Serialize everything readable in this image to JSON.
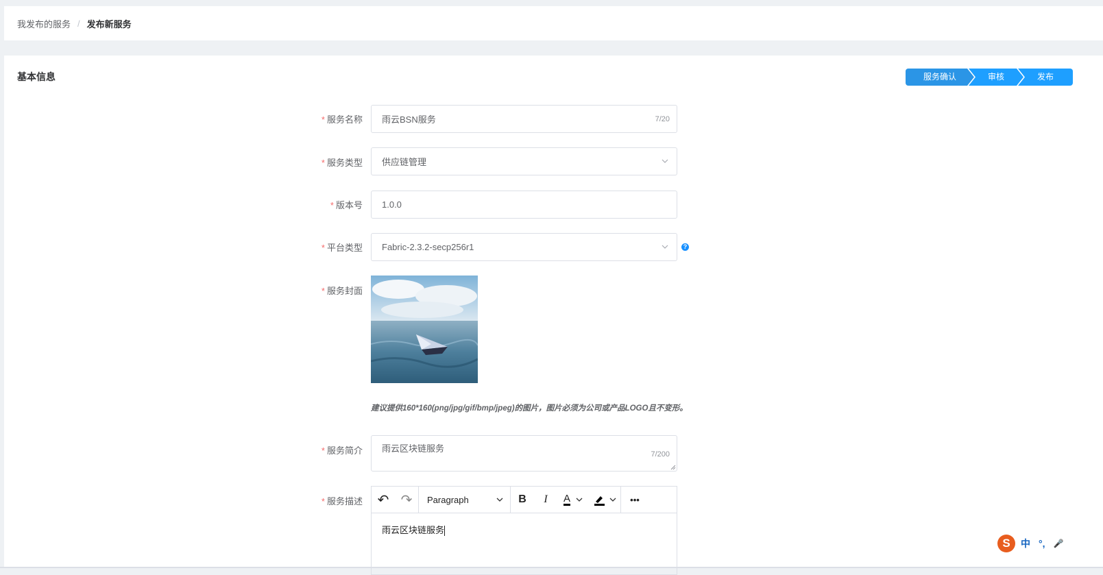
{
  "breadcrumb": {
    "parent": "我发布的服务",
    "separator": "/",
    "current": "发布新服务"
  },
  "section_title": "基本信息",
  "steps": [
    "服务确认",
    "审核",
    "发布"
  ],
  "form": {
    "required_mark": "*",
    "name": {
      "label": "服务名称",
      "value": "雨云BSN服务",
      "counter": "7/20"
    },
    "type": {
      "label": "服务类型",
      "value": "供应链管理"
    },
    "version": {
      "label": "版本号",
      "value": "1.0.0"
    },
    "platform": {
      "label": "平台类型",
      "value": "Fabric-2.3.2-secp256r1",
      "help": "?"
    },
    "cover": {
      "label": "服务封面",
      "hint": "建议提供160*160(png/jpg/gif/bmp/jpeg)的图片，图片必须为公司或产品LOGO且不变形。"
    },
    "intro": {
      "label": "服务简介",
      "value": "雨云区块链服务",
      "counter": "7/200"
    },
    "desc": {
      "label": "服务描述",
      "block_format": "Paragraph",
      "content": "雨云区块链服务"
    }
  },
  "editor_toolbar": {
    "undo": "↶",
    "redo": "↷",
    "bold": "B",
    "italic": "I",
    "font_color": "A",
    "more": "•••"
  },
  "ime": {
    "logo": "S",
    "lang": "中",
    "punct": "°,",
    "mic": "🎤"
  },
  "colors": {
    "accent": "#1e9fff",
    "required": "#f56c6c",
    "border": "#dcdfe6"
  }
}
